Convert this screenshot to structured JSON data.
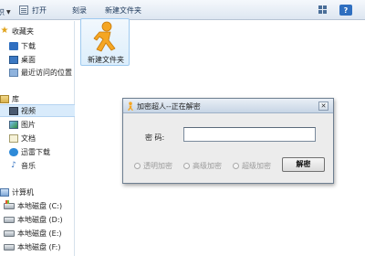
{
  "toolbar": {
    "cut_label": "织",
    "open_label": "打开",
    "burn_label": "刻录",
    "new_folder_label": "新建文件夹"
  },
  "nav": {
    "favorites_header": "收藏夹",
    "favorites": [
      "下载",
      "桌面",
      "最近访问的位置"
    ],
    "libraries_header": "库",
    "libraries": [
      "视频",
      "图片",
      "文档",
      "迅雷下载",
      "音乐"
    ],
    "computer_header": "计算机",
    "drives": [
      "本地磁盘 (C:)",
      "本地磁盘 (D:)",
      "本地磁盘 (E:)",
      "本地磁盘 (F:)"
    ],
    "selected": "视频"
  },
  "file": {
    "name": "新建文件夹",
    "icon": "aim-running-man-icon"
  },
  "dialog": {
    "title": "加密超人--正在解密",
    "password_label": "密  码:",
    "password_value": "",
    "options": [
      "透明加密",
      "高级加密",
      "超级加密"
    ],
    "decrypt_label": "解密"
  },
  "colors": {
    "selection": "#d9ebfb",
    "aim_orange": "#f5a623",
    "dialog_bg": "#ececec"
  }
}
